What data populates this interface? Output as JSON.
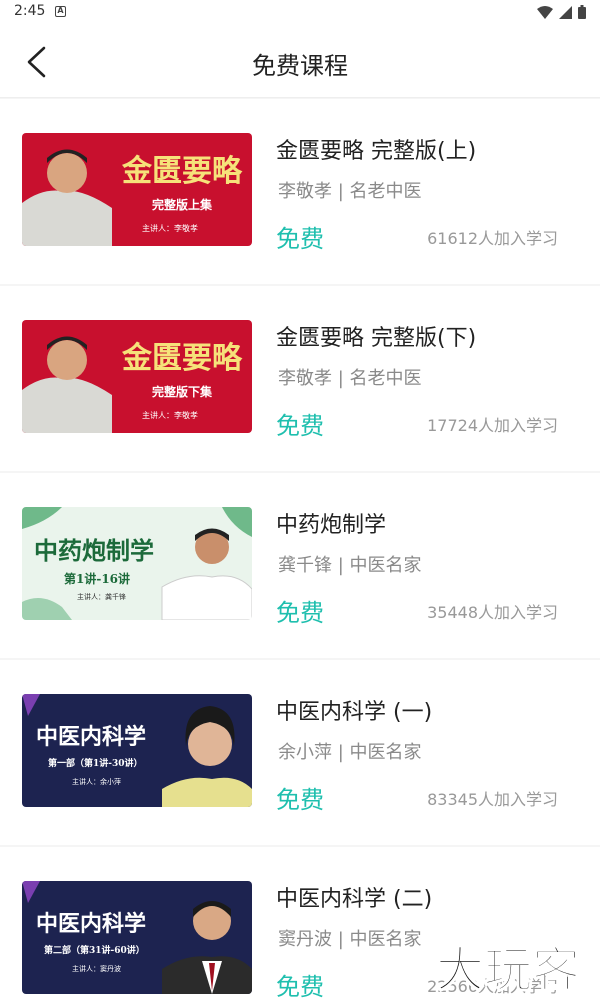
{
  "status": {
    "time": "2:45",
    "notif_glyph": "A"
  },
  "header": {
    "title": "免费课程"
  },
  "courses": [
    {
      "title": "金匮要略 完整版(上)",
      "teacher": "李敬孝",
      "tag": "名老中医",
      "teacher_line": "李敬孝 | 名老中医",
      "price": "免费",
      "count": "61612人加入学习",
      "thumb": {
        "main": "金匮要略",
        "sub": "完整版上集",
        "lecturer": "主讲人：李敬孝",
        "style": "red"
      }
    },
    {
      "title": "金匮要略 完整版(下)",
      "teacher": "李敬孝",
      "tag": "名老中医",
      "teacher_line": "李敬孝 | 名老中医",
      "price": "免费",
      "count": "17724人加入学习",
      "thumb": {
        "main": "金匮要略",
        "sub": "完整版下集",
        "lecturer": "主讲人：李敬孝",
        "style": "red"
      }
    },
    {
      "title": "中药炮制学",
      "teacher": "龚千锋",
      "tag": "中医名家",
      "teacher_line": "龚千锋 | 中医名家",
      "price": "免费",
      "count": "35448人加入学习",
      "thumb": {
        "main": "中药炮制学",
        "sub": "第1讲-16讲",
        "lecturer": "主讲人：龚千锋",
        "style": "green"
      }
    },
    {
      "title": "中医内科学 (一)",
      "teacher": "余小萍",
      "tag": "中医名家",
      "teacher_line": "余小萍 | 中医名家",
      "price": "免费",
      "count": "83345人加入学习",
      "thumb": {
        "main": "中医内科学",
        "sub": "第一部（第1讲-30讲）",
        "lecturer": "主讲人：余小萍",
        "style": "navy"
      }
    },
    {
      "title": "中医内科学 (二)",
      "teacher": "窦丹波",
      "tag": "中医名家",
      "teacher_line": "窦丹波 | 中医名家",
      "price": "免费",
      "count": "22566人加入学习",
      "thumb": {
        "main": "中医内科学",
        "sub": "第二部（第31讲-60讲）",
        "lecturer": "主讲人：窦丹波",
        "style": "navy"
      }
    }
  ],
  "watermark": {
    "text": "大玩客"
  },
  "colors": {
    "accent": "#1fbfae",
    "thumb_red": "#c8102e",
    "thumb_navy": "#1d2350",
    "thumb_green": "#e8f3ea"
  },
  "icons": {
    "back": "chevron-left-icon",
    "wifi": "wifi-icon",
    "signal": "signal-icon",
    "battery": "battery-icon"
  }
}
